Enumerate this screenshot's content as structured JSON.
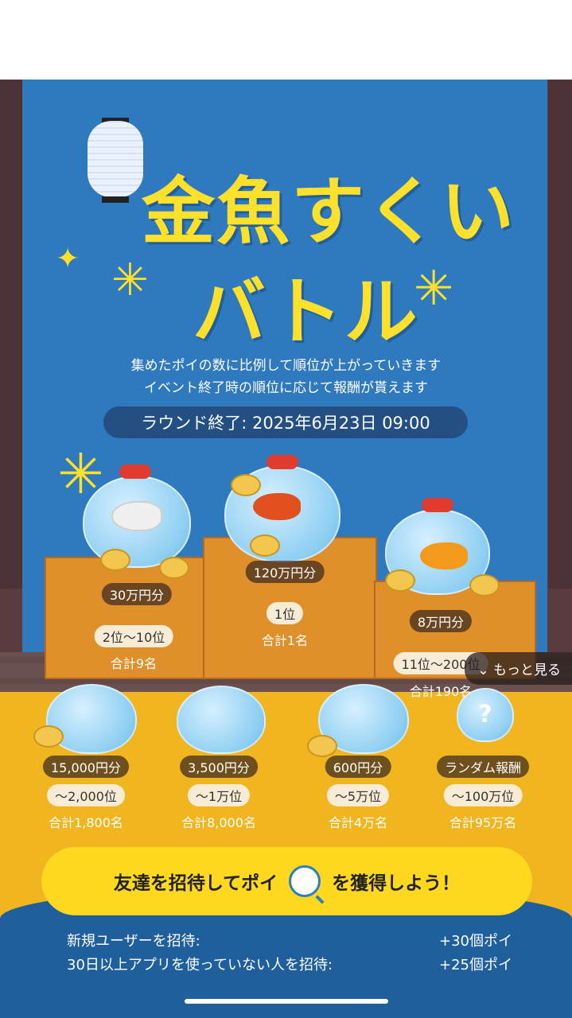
{
  "title": {
    "line1": "金魚すくい",
    "line2": "バトル"
  },
  "description": {
    "line1": "集めたポイの数に比例して順位が上がっていきます",
    "line2": "イベント終了時の順位に応じて報酬が貰えます"
  },
  "round_end": "ラウンド終了: 2025年6月23日 09:00",
  "top_prizes": [
    {
      "amount": "30万円分",
      "rank": "2位〜10位",
      "count": "合計9名"
    },
    {
      "amount": "120万円分",
      "rank": "1位",
      "count": "合計1名"
    },
    {
      "amount": "8万円分",
      "rank": "11位〜200位",
      "count": "合計190名"
    }
  ],
  "lower_prizes": [
    {
      "amount": "15,000円分",
      "rank": "〜2,000位",
      "count": "合計1,800名"
    },
    {
      "amount": "3,500円分",
      "rank": "〜1万位",
      "count": "合計8,000名"
    },
    {
      "amount": "600円分",
      "rank": "〜5万位",
      "count": "合計4万名"
    },
    {
      "amount": "ランダム報酬",
      "rank": "〜100万位",
      "count": "合計95万名"
    }
  ],
  "more_button": "もっと見る",
  "invite": {
    "pre": "友達を招待してポイ",
    "post": "を獲得しよう！"
  },
  "invite_rewards": [
    {
      "label": "新規ユーザーを招待:",
      "value": "+30個ポイ"
    },
    {
      "label": "30日以上アプリを使っていない人を招待:",
      "value": "+25個ポイ"
    }
  ],
  "colors": {
    "banner": "#2f79bf",
    "title": "#ffe02a",
    "stage": "#f1b51f",
    "invite_button": "#ffd81f"
  }
}
